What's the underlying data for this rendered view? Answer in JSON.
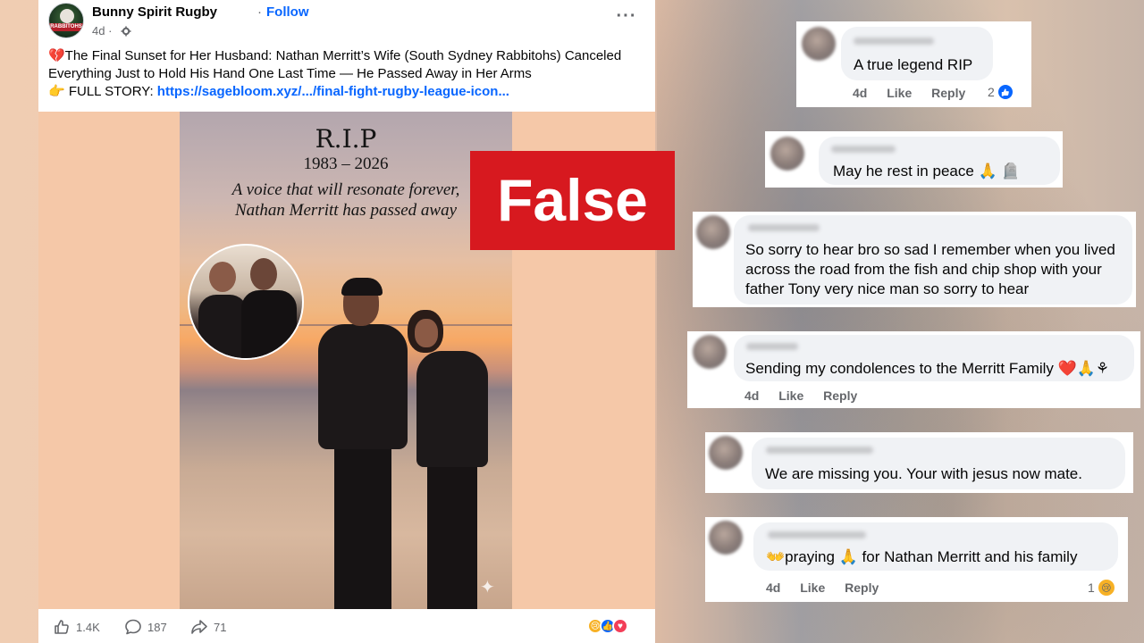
{
  "post": {
    "page_name": "Bunny Spirit Rugby",
    "separator": "·",
    "follow_label": "Follow",
    "time": "4d ·",
    "avatar_text": "RABBITOHS",
    "text_line1": "💔The Final Sunset for Her Husband: Nathan Merritt’s Wife (South Sydney Rabbitohs) Canceled",
    "text_line2": "Everything Just to Hold His Hand One Last Time — He Passed Away in Her Arms",
    "text_line3_prefix": "👉 FULL STORY: ",
    "link_text": "https://sagebloom.xyz/.../final-fight-rugby-league-icon...",
    "image": {
      "title": "R.I.P",
      "years": "1983 – 2026",
      "quote_line1": "A voice that will resonate forever,",
      "quote_line2": "Nathan Merritt has passed away"
    },
    "footer": {
      "likes": "1.4K",
      "comments": "187",
      "shares": "71"
    }
  },
  "stamp": {
    "label": "False",
    "color": "#d7191f"
  },
  "comments": [
    {
      "text": "A true legend RIP",
      "time": "4d",
      "like": "Like",
      "reply": "Reply",
      "reaction_count": "2",
      "reaction": "like"
    },
    {
      "text": "May he rest in peace 🙏 🪦"
    },
    {
      "line1": "So sorry to hear bro so sad I remember when you lived",
      "line2": "across the road from the fish and chip shop with your",
      "line3": "father Tony very nice man so sorry to hear"
    },
    {
      "text": "Sending my condolences to the Merritt Family ❤️🙏⚘",
      "time": "4d",
      "like": "Like",
      "reply": "Reply"
    },
    {
      "text": "We are missing you. Your with jesus now mate."
    },
    {
      "text": "👐praying 🙏 for Nathan Merritt and his family",
      "time": "4d",
      "like": "Like",
      "reply": "Reply",
      "reaction_count": "1",
      "reaction": "sad"
    }
  ],
  "colors": {
    "facebook_blue": "#0866ff",
    "secondary_text": "#65676b",
    "bubble": "#f0f2f5"
  }
}
